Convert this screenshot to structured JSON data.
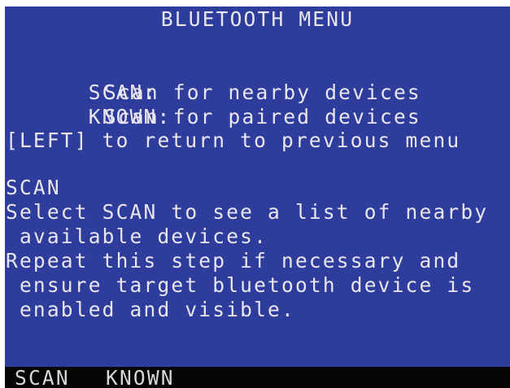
{
  "menu": {
    "title": "BLUETOOTH MENU",
    "options": [
      {
        "key": "SCAN:",
        "description": "Scan for nearby devices"
      },
      {
        "key": "KNOWN:",
        "description": "Scan for paired devices"
      }
    ],
    "back_hint": "[LEFT] to return to previous menu"
  },
  "help": {
    "heading": "SCAN",
    "lines": [
      "Select SCAN to see a list of nearby",
      " available devices.",
      "Repeat this step if necessary and",
      " ensure target bluetooth device is",
      " enabled and visible."
    ]
  },
  "softkeys": {
    "scan_label": "SCAN",
    "known_label": "KNOWN"
  },
  "colors": {
    "screen_background": "#2e3d9b",
    "text": "#e9e6f0",
    "softkey_bar": "#050505"
  }
}
